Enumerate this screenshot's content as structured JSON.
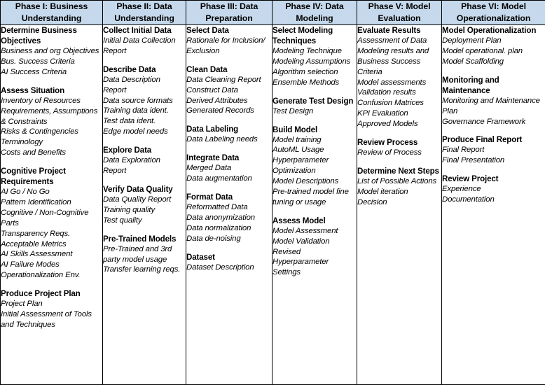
{
  "table": {
    "title": "Cognitive Project Management for AI (CPMAI) Phase Table",
    "header_background": "#c6d9ec",
    "border_color": "#000000",
    "columns": [
      {
        "id": "phase-1",
        "header": "Phase I: Business Understanding",
        "groups": [
          {
            "title": "Determine Business Objectives",
            "items": [
              "Business and org Objectives",
              "Bus. Success Criteria",
              "AI Success Criteria"
            ]
          },
          {
            "title": "Assess Situation",
            "items": [
              "Inventory of Resources",
              "Requirements, Assumptions & Constraints",
              "Risks & Contingencies",
              "Terminology",
              "Costs and Benefits"
            ]
          },
          {
            "title": "Cognitive Project Requirements",
            "items": [
              "AI Go / No Go",
              "Pattern Identification",
              "Cognitive / Non-Cognitive Parts",
              "Transparency Reqs.",
              "Acceptable Metrics",
              "AI Skills Assessment",
              "AI Failure Modes",
              "Operationalization Env."
            ]
          },
          {
            "title": "Produce Project Plan",
            "items": [
              "Project Plan",
              "Initial Assessment of Tools and Techniques"
            ]
          }
        ]
      },
      {
        "id": "phase-2",
        "header": "Phase II: Data Understanding",
        "groups": [
          {
            "title": "Collect Initial Data",
            "items": [
              "Initial Data Collection Report"
            ]
          },
          {
            "title": "Describe Data",
            "items": [
              "Data Description Report",
              "Data source formats",
              "Training data ident.",
              "Test data ident.",
              "Edge model needs"
            ]
          },
          {
            "title": "Explore Data",
            "items": [
              "Data Exploration Report"
            ]
          },
          {
            "title": "Verify Data Quality",
            "items": [
              "Data Quality Report",
              "Training quality",
              "Test quality"
            ]
          },
          {
            "title": "Pre-Trained Models",
            "items": [
              "Pre-Trained and 3rd party model usage",
              "Transfer learning reqs."
            ]
          }
        ]
      },
      {
        "id": "phase-3",
        "header": "Phase III: Data Preparation",
        "groups": [
          {
            "title": "Select Data",
            "items": [
              "Rationale for Inclusion/ Exclusion"
            ]
          },
          {
            "title": "Clean Data",
            "items": [
              "Data Cleaning Report",
              "Construct Data",
              "Derived Attributes",
              "Generated Records"
            ]
          },
          {
            "title": "Data Labeling",
            "items": [
              "Data Labeling needs"
            ]
          },
          {
            "title": "Integrate Data",
            "items": [
              "Merged Data",
              "Data augmentation"
            ]
          },
          {
            "title": "Format Data",
            "items": [
              "Reformatted Data",
              "Data anonymization",
              "Data normalization",
              "Data de-noising"
            ]
          },
          {
            "title": "Dataset",
            "items": [
              "Dataset Description"
            ]
          }
        ]
      },
      {
        "id": "phase-4",
        "header": "Phase IV: Data Modeling",
        "groups": [
          {
            "title": "Select Modeling Techniques",
            "items": [
              "Modeling Technique",
              "Modeling Assumptions",
              "Algorithm selection",
              "Ensemble Methods"
            ]
          },
          {
            "title": "Generate Test Design",
            "items": [
              "Test Design"
            ]
          },
          {
            "title": "Build Model",
            "items": [
              "Model training",
              "AutoML Usage",
              "Hyperparameter Optimization",
              "Model Descriptions",
              "Pre-trained model fine tuning or usage"
            ]
          },
          {
            "title": "Assess Model",
            "items": [
              "Model Assessment",
              "Model Validation",
              "Revised Hyperparameter Settings"
            ]
          }
        ]
      },
      {
        "id": "phase-5",
        "header": "Phase V: Model Evaluation",
        "groups": [
          {
            "title": "Evaluate Results",
            "items": [
              "Assessment of Data Modeling results and Business Success Criteria",
              "Model assessments",
              "Validation results",
              "Confusion Matrices",
              "KPI Evaluation",
              "Approved Models"
            ]
          },
          {
            "title": "Review Process",
            "items": [
              "Review of Process"
            ]
          },
          {
            "title": "Determine Next Steps",
            "items": [
              "List of Possible Actions",
              "Model iteration",
              "Decision"
            ]
          }
        ]
      },
      {
        "id": "phase-6",
        "header": "Phase VI: Model Operationalization",
        "groups": [
          {
            "title": "Model Operationalization",
            "items": [
              "Deployment Plan",
              "Model operational. plan",
              "Model Scaffolding"
            ]
          },
          {
            "title": "Monitoring and Maintenance",
            "items": [
              "Monitoring and Maintenance Plan",
              "Governance Framework"
            ]
          },
          {
            "title": "Produce Final Report",
            "items": [
              "Final Report",
              "Final Presentation"
            ]
          },
          {
            "title": "Review Project",
            "items": [
              "Experience",
              "Documentation"
            ]
          }
        ]
      }
    ]
  }
}
